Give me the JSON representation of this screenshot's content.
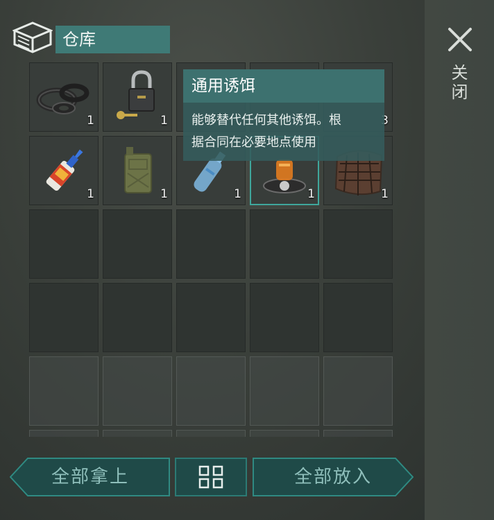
{
  "header": {
    "title": "仓库",
    "icon": "storage-box-icon"
  },
  "close": {
    "label": "关闭",
    "icon": "close-icon"
  },
  "slots": [
    {
      "item": "rubber-seals-icon",
      "qty": "1"
    },
    {
      "item": "padlock-with-key-icon",
      "qty": "1"
    },
    {
      "item": "hidden-under-tooltip",
      "qty": ""
    },
    {
      "item": "hidden-under-tooltip",
      "qty": ""
    },
    {
      "item": "hidden-under-tooltip",
      "qty": "3"
    },
    {
      "item": "super-glue-icon",
      "qty": "1"
    },
    {
      "item": "jerrycan-icon",
      "qty": "1"
    },
    {
      "item": "plastic-bottle-icon",
      "qty": "1"
    },
    {
      "item": "universal-bait-icon",
      "qty": "1"
    },
    {
      "item": "net-icon",
      "qty": "1"
    }
  ],
  "tooltip": {
    "title": "通用诱饵",
    "description_line1": "能够替代任何其他诱饵。根",
    "description_line2": "据合同在必要地点使用"
  },
  "buttons": {
    "take_all": "全部拿上",
    "sort_icon": "sort-grid-icon",
    "put_all": "全部放入"
  },
  "colors": {
    "accent": "#3fa79c",
    "title_bg": "#3f7a76",
    "button_text": "#8fbfbb"
  }
}
